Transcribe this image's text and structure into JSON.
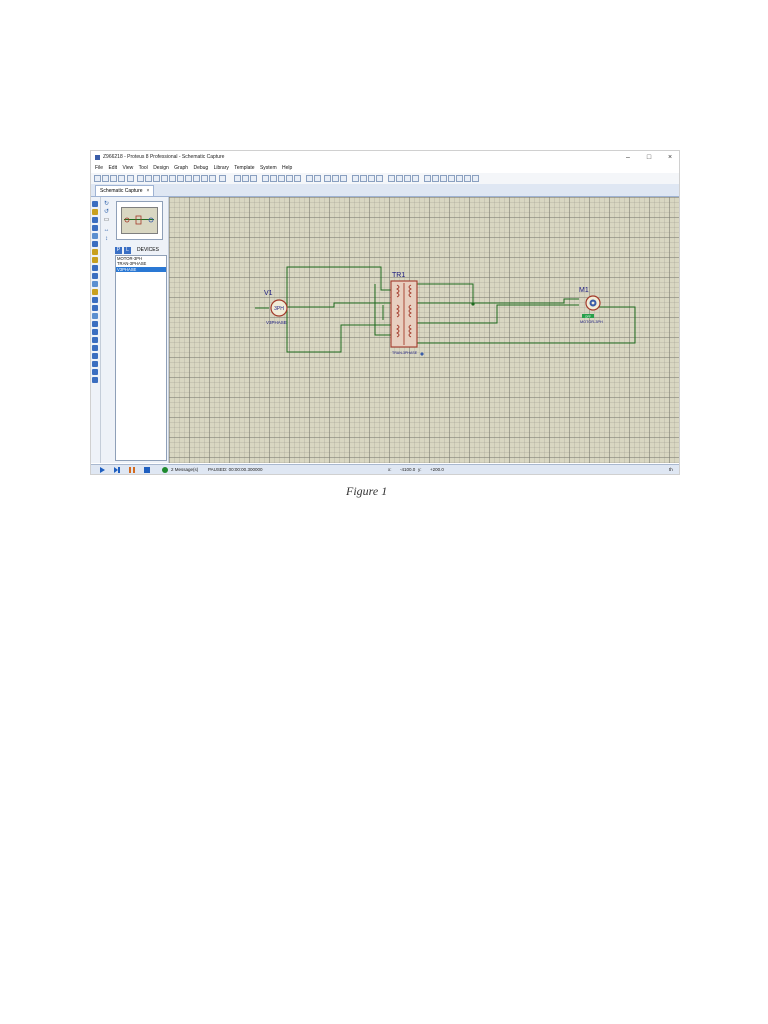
{
  "window": {
    "title": "Z966218 - Proteus 8 Professional - Schematic Capture",
    "controls": {
      "minimize": "–",
      "maximize": "□",
      "close": "×"
    }
  },
  "menu": [
    "File",
    "Edit",
    "View",
    "Tool",
    "Design",
    "Graph",
    "Debug",
    "Library",
    "Template",
    "System",
    "Help"
  ],
  "tab": {
    "label": "Schematic Capture",
    "close": "×"
  },
  "devices": {
    "header": "DEVICES",
    "p_button": "P",
    "l_button": "L",
    "items": [
      "MOTOR-3PH",
      "TRAN-3PHASE",
      "V3PHASE"
    ],
    "selected_index": 2
  },
  "schematic": {
    "source": {
      "ref": "V1",
      "value": "V3PHASE",
      "symbol": "3PH"
    },
    "transformer": {
      "ref": "TR1",
      "value": "TRAN-3PHASE"
    },
    "motor": {
      "ref": "M1",
      "part": "MOTOR-3PH",
      "tag": "OFF"
    }
  },
  "status": {
    "messages": "2 Message(s)",
    "sim_state": "PAUSED: 00:00:00.300000",
    "x_label": "x:",
    "x_value": "-4100.0",
    "y_label": "y:",
    "y_value": "+200.0",
    "unit": "th"
  },
  "caption": "Figure 1",
  "colors": {
    "canvas": "#d9d7c2",
    "wire": "#1e6b1e",
    "component": "#a33a2a",
    "selection": "#2a78d4",
    "accent": "#3a6fc4"
  }
}
